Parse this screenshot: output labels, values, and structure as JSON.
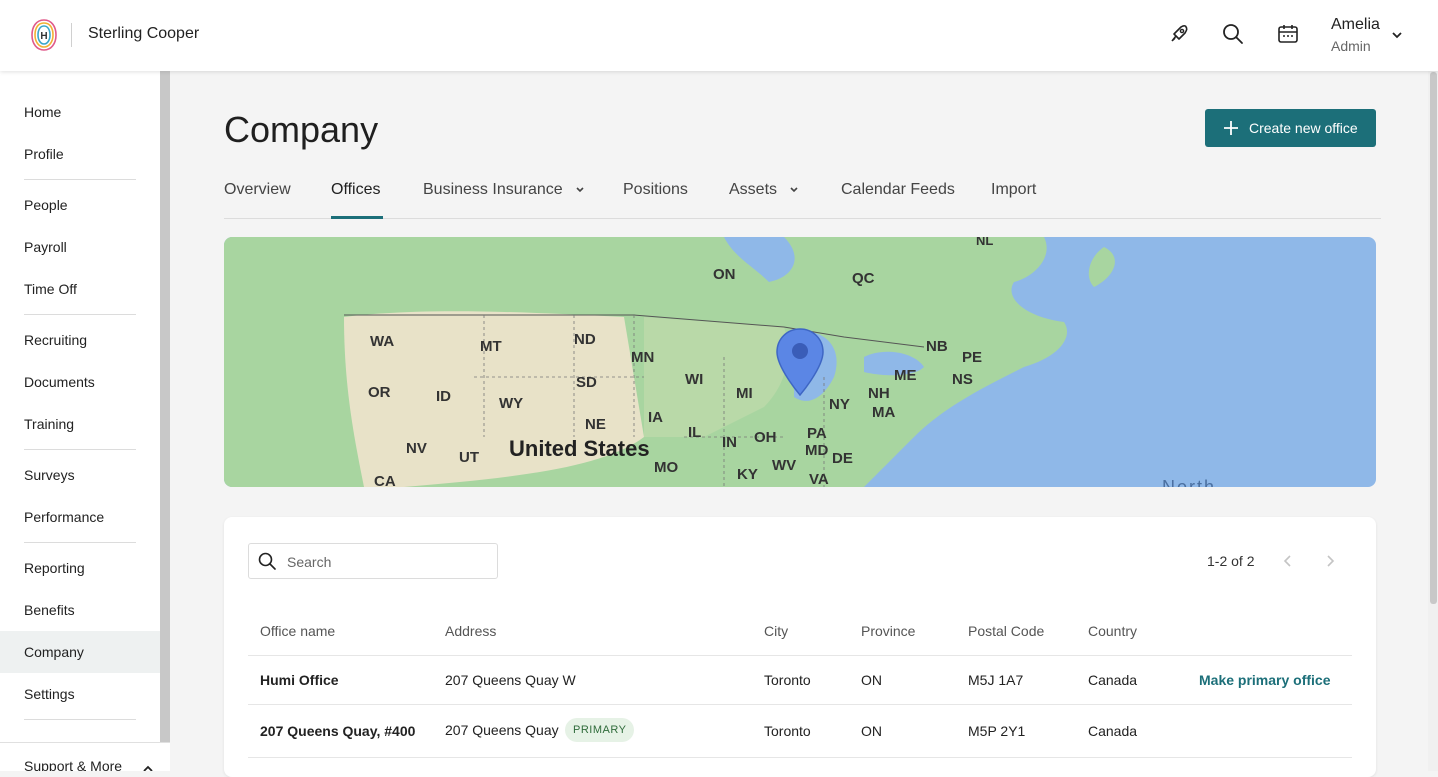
{
  "header": {
    "brand": "Sterling Cooper",
    "user_name": "Amelia",
    "user_role": "Admin"
  },
  "sidebar": {
    "items": [
      {
        "label": "Home"
      },
      {
        "label": "Profile"
      },
      {
        "label": "People"
      },
      {
        "label": "Payroll"
      },
      {
        "label": "Time Off"
      },
      {
        "label": "Recruiting"
      },
      {
        "label": "Documents"
      },
      {
        "label": "Training"
      },
      {
        "label": "Surveys"
      },
      {
        "label": "Performance"
      },
      {
        "label": "Reporting"
      },
      {
        "label": "Benefits"
      },
      {
        "label": "Company"
      },
      {
        "label": "Settings"
      }
    ],
    "support_label": "Support & More"
  },
  "main": {
    "title": "Company",
    "create_button": "Create new office",
    "tabs": [
      {
        "label": "Overview"
      },
      {
        "label": "Offices"
      },
      {
        "label": "Business Insurance"
      },
      {
        "label": "Positions"
      },
      {
        "label": "Assets"
      },
      {
        "label": "Calendar Feeds"
      },
      {
        "label": "Import"
      }
    ]
  },
  "map": {
    "labels": [
      "NL",
      "ON",
      "QC",
      "WA",
      "MT",
      "ND",
      "MN",
      "NB",
      "PE",
      "NS",
      "OR",
      "ID",
      "SD",
      "WI",
      "MI",
      "ME",
      "NH",
      "MA",
      "NY",
      "WY",
      "NE",
      "IA",
      "IL",
      "IN",
      "OH",
      "PA",
      "NV",
      "UT",
      "MO",
      "MD",
      "DE",
      "KY",
      "WV",
      "VA",
      "CA"
    ],
    "country": "United States",
    "ocean": "North"
  },
  "offices": {
    "search_placeholder": "Search",
    "pager": "1-2 of 2",
    "columns": [
      "Office name",
      "Address",
      "City",
      "Province",
      "Postal Code",
      "Country"
    ],
    "rows": [
      {
        "name": "Humi Office",
        "address": "207 Queens Quay W",
        "city": "Toronto",
        "province": "ON",
        "postal": "M5J 1A7",
        "country": "Canada",
        "action": "Make primary office"
      },
      {
        "name": "207 Queens Quay, #400",
        "address": "207 Queens Quay",
        "badge": "PRIMARY",
        "city": "Toronto",
        "province": "ON",
        "postal": "M5P 2Y1",
        "country": "Canada"
      }
    ]
  },
  "colors": {
    "accent": "#1c6f79",
    "map_water": "#8fb8e8",
    "map_land": "#a8d5a0",
    "primary_badge_bg": "#e6f2e6"
  }
}
